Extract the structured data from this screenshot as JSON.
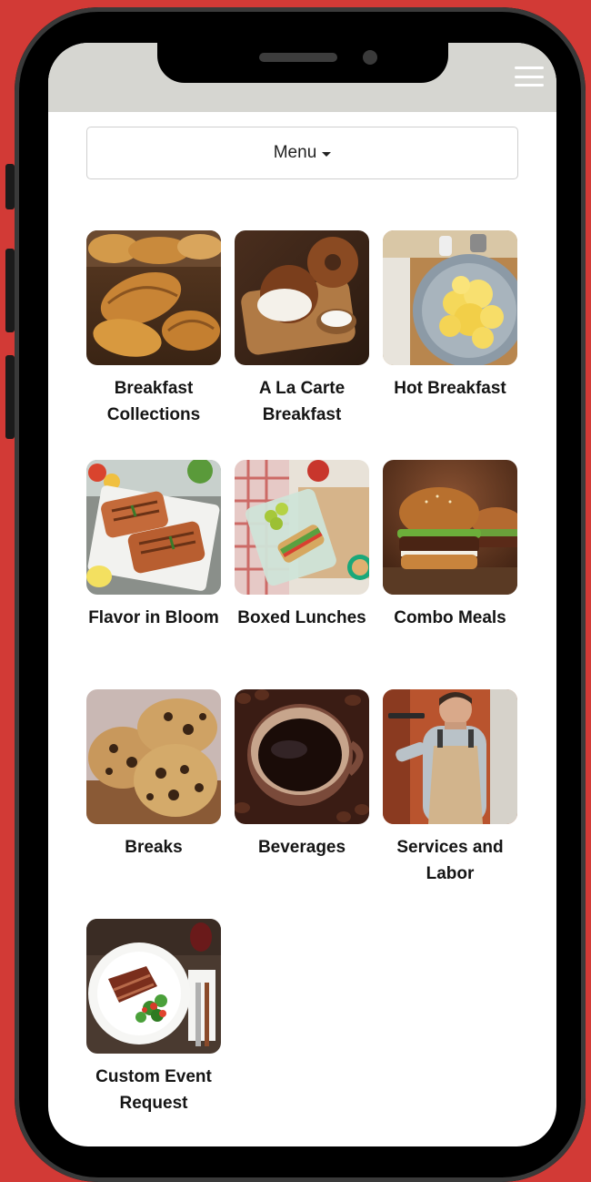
{
  "header": {
    "menu_icon": "hamburger-icon"
  },
  "menu_button": {
    "label": "Menu",
    "icon": "caret-down-icon"
  },
  "categories": [
    {
      "label": "Breakfast Collections",
      "image": "croissants"
    },
    {
      "label": "A La Carte Breakfast",
      "image": "bagels"
    },
    {
      "label": "Hot Breakfast",
      "image": "scrambled-eggs"
    },
    {
      "label": "Flavor in Bloom",
      "image": "grilled-salmon"
    },
    {
      "label": "Boxed Lunches",
      "image": "sandwich-box"
    },
    {
      "label": "Combo Meals",
      "image": "burgers"
    },
    {
      "label": "Breaks",
      "image": "cookies"
    },
    {
      "label": "Beverages",
      "image": "coffee-cup"
    },
    {
      "label": "Services and Labor",
      "image": "waiter"
    },
    {
      "label": "Custom Event Request",
      "image": "steak-plate"
    }
  ],
  "colors": {
    "background": "#d23a36",
    "header_bar": "#d6d6d1"
  }
}
